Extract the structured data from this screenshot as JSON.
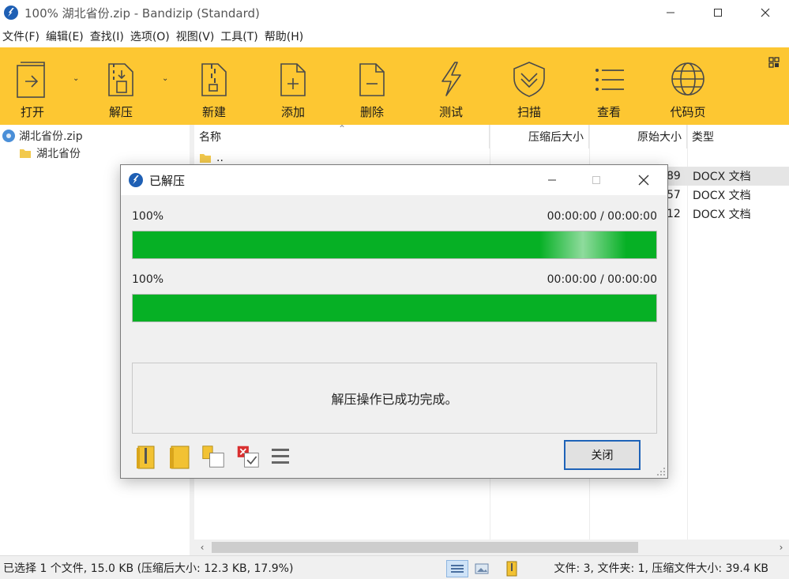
{
  "window": {
    "title": "100% 湖北省份.zip - Bandizip (Standard)",
    "controls": [
      "minimize-icon",
      "maximize-icon",
      "close-icon"
    ]
  },
  "menu": [
    {
      "label": "文件(F)"
    },
    {
      "label": "编辑(E)"
    },
    {
      "label": "查找(I)"
    },
    {
      "label": "选项(O)"
    },
    {
      "label": "视图(V)"
    },
    {
      "label": "工具(T)"
    },
    {
      "label": "帮助(H)"
    }
  ],
  "toolbar": {
    "background": "#fdc732",
    "buttons": [
      {
        "label": "打开",
        "icon": "open-archive-icon"
      },
      {
        "label": "解压",
        "icon": "extract-archive-icon"
      },
      {
        "label": "新建",
        "icon": "new-archive-icon"
      },
      {
        "label": "添加",
        "icon": "add-file-icon"
      },
      {
        "label": "删除",
        "icon": "delete-file-icon"
      },
      {
        "label": "测试",
        "icon": "test-lightning-icon"
      },
      {
        "label": "扫描",
        "icon": "scan-shield-icon"
      },
      {
        "label": "查看",
        "icon": "view-list-icon"
      },
      {
        "label": "代码页",
        "icon": "codepage-globe-icon"
      }
    ]
  },
  "tree": {
    "items": [
      {
        "label": "湖北省份.zip",
        "icon": "archive-disc-icon"
      },
      {
        "label": "湖北省份",
        "icon": "folder-icon"
      }
    ]
  },
  "filelist": {
    "columns": [
      "名称",
      "压缩后大小",
      "原始大小",
      "类型"
    ],
    "rows": [
      {
        "name": "..",
        "original_tail": "",
        "type": ""
      },
      {
        "name": "",
        "original_tail": "89",
        "type": "DOCX 文档",
        "selected": true
      },
      {
        "name": "",
        "original_tail": "57",
        "type": "DOCX 文档"
      },
      {
        "name": "",
        "original_tail": "12",
        "type": "DOCX 文档"
      }
    ]
  },
  "dialog": {
    "title": "已解压",
    "progress": [
      {
        "percent_label": "100%",
        "time": "00:00:00 / 00:00:00",
        "value": 1.0
      },
      {
        "percent_label": "100%",
        "time": "00:00:00 / 00:00:00",
        "value": 1.0
      }
    ],
    "message": "解压操作已成功完成。",
    "close_label": "关闭",
    "bar_color": "#06b025",
    "bottom_icons": [
      "open-extracted-folder-icon",
      "open-folder-icon",
      "copy-to-folder-icon",
      "delete-archive-icon",
      "menu-lines-icon"
    ]
  },
  "status": {
    "left": "已选择 1 个文件, 15.0 KB (压缩后大小: 12.3 KB, 17.9%)",
    "right": "文件: 3, 文件夹: 1, 压缩文件大小: 39.4 KB"
  }
}
